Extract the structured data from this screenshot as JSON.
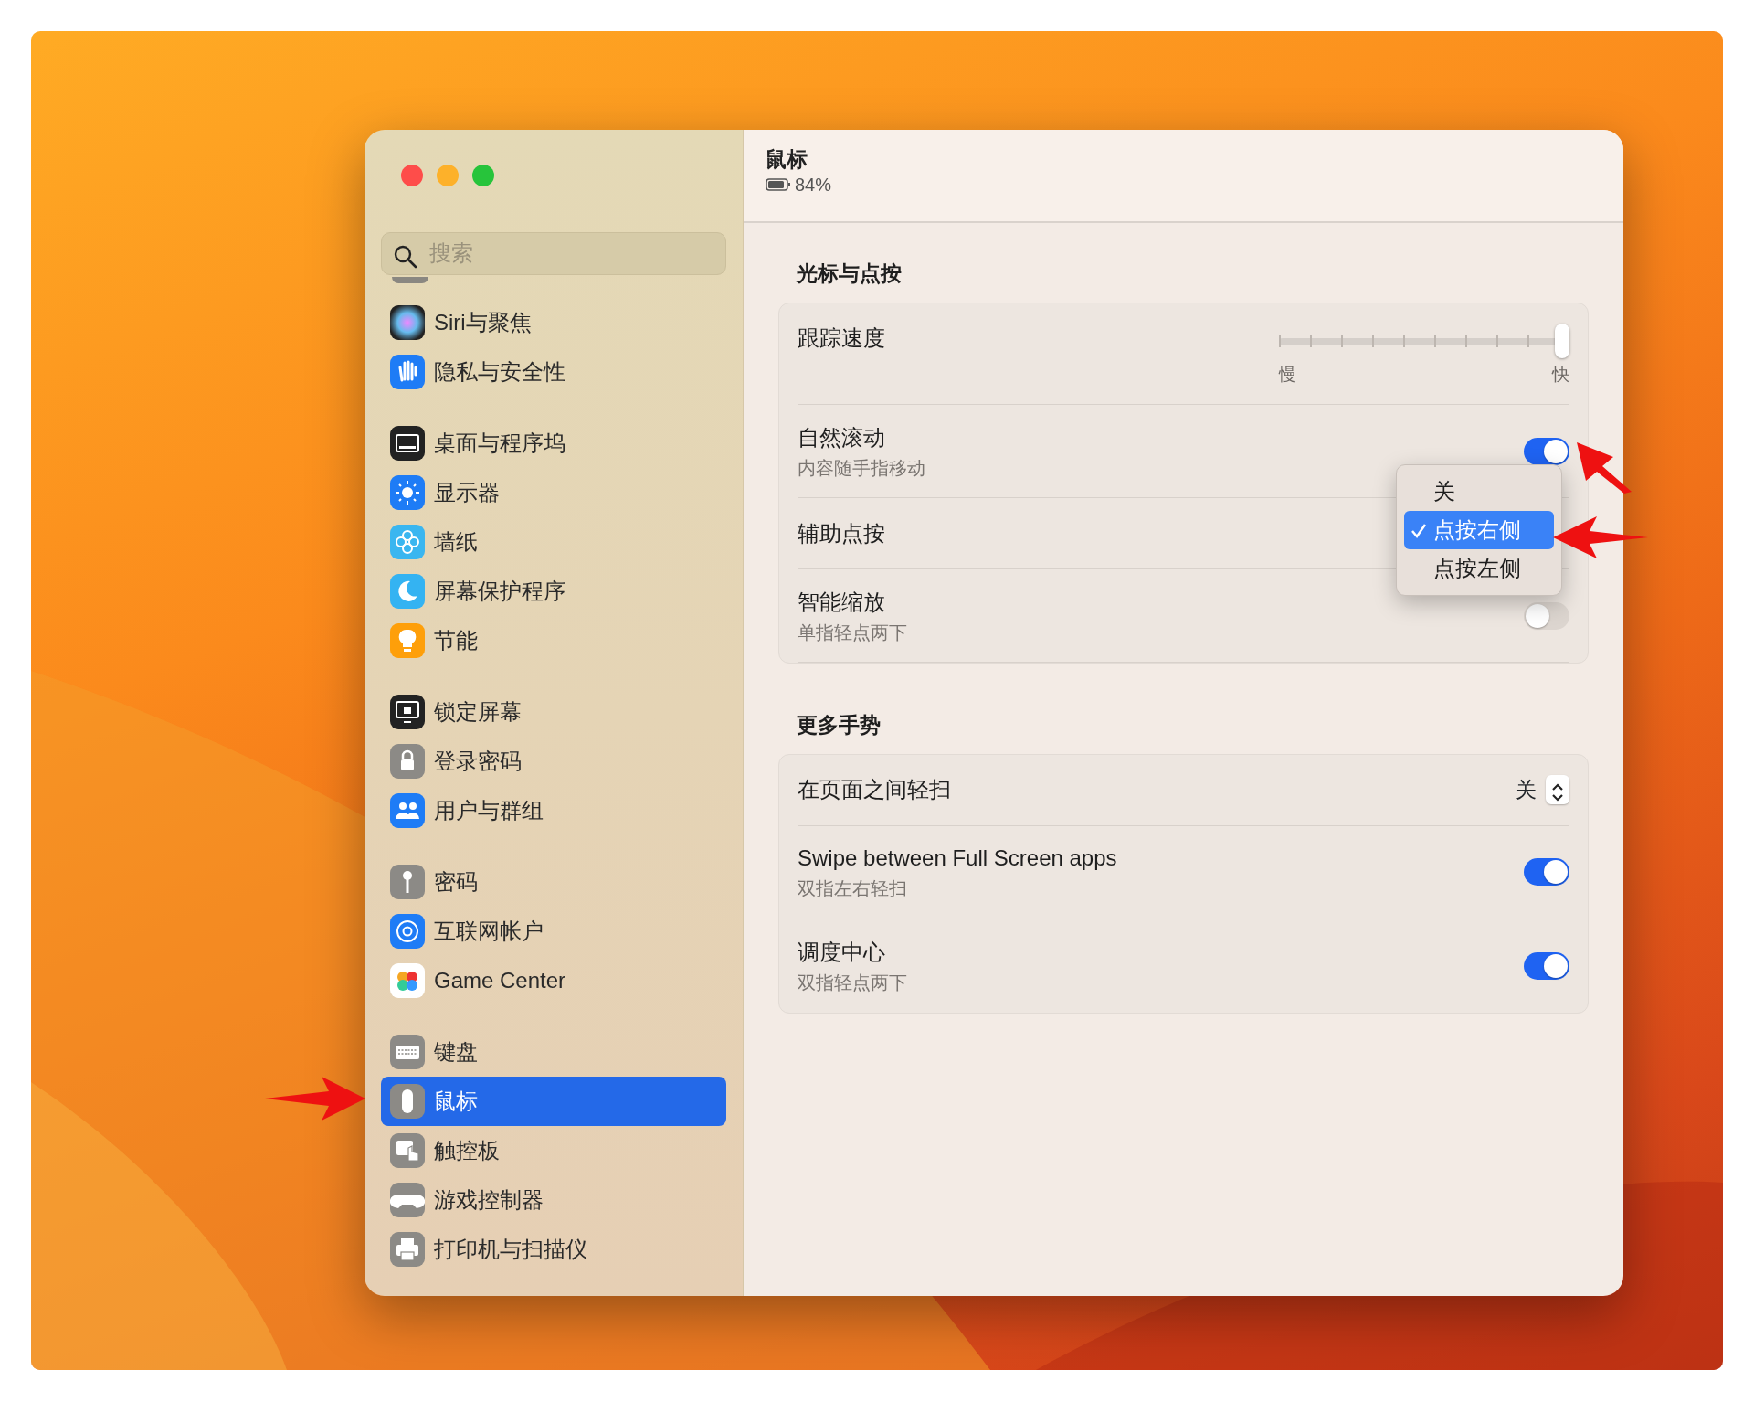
{
  "sidebar": {
    "search": {
      "placeholder": "搜索"
    },
    "groups": [
      {
        "items": [
          {
            "label": "Siri与聚焦",
            "selected": false
          },
          {
            "label": "隐私与安全性",
            "selected": false
          }
        ]
      },
      {
        "items": [
          {
            "label": "桌面与程序坞",
            "selected": false
          },
          {
            "label": "显示器",
            "selected": false
          },
          {
            "label": "墙纸",
            "selected": false
          },
          {
            "label": "屏幕保护程序",
            "selected": false
          },
          {
            "label": "节能",
            "selected": false
          }
        ]
      },
      {
        "items": [
          {
            "label": "锁定屏幕",
            "selected": false
          },
          {
            "label": "登录密码",
            "selected": false
          },
          {
            "label": "用户与群组",
            "selected": false
          }
        ]
      },
      {
        "items": [
          {
            "label": "密码",
            "selected": false
          },
          {
            "label": "互联网帐户",
            "selected": false
          },
          {
            "label": "Game Center",
            "selected": false
          }
        ]
      },
      {
        "items": [
          {
            "label": "键盘",
            "selected": false
          },
          {
            "label": "鼠标",
            "selected": true
          },
          {
            "label": "触控板",
            "selected": false
          },
          {
            "label": "游戏控制器",
            "selected": false
          },
          {
            "label": "打印机与扫描仪",
            "selected": false
          }
        ]
      }
    ]
  },
  "header": {
    "title": "鼠标",
    "battery": "84%"
  },
  "sections": [
    {
      "title": "光标与点按",
      "rows": [
        {
          "kind": "slider",
          "label": "跟踪速度",
          "level": 1.0,
          "min_label": "慢",
          "max_label": "快"
        },
        {
          "kind": "toggle",
          "label": "自然滚动",
          "subtitle": "内容随手指移动",
          "on": true
        },
        {
          "kind": "popup",
          "label": "辅助点按"
        },
        {
          "kind": "toggle",
          "label": "智能缩放",
          "subtitle": "单指轻点两下",
          "on": false
        }
      ]
    },
    {
      "title": "更多手势",
      "rows": [
        {
          "kind": "stepper",
          "label": "在页面之间轻扫",
          "value": "关"
        },
        {
          "kind": "toggle",
          "label": "Swipe between Full Screen apps",
          "subtitle": "双指左右轻扫",
          "on": true
        },
        {
          "kind": "toggle",
          "label": "调度中心",
          "subtitle": "双指轻点两下",
          "on": true
        }
      ]
    }
  ],
  "menu": {
    "options": [
      {
        "label": "关",
        "selected": false
      },
      {
        "label": "点按右侧",
        "selected": true
      },
      {
        "label": "点按左侧",
        "selected": false
      }
    ]
  }
}
